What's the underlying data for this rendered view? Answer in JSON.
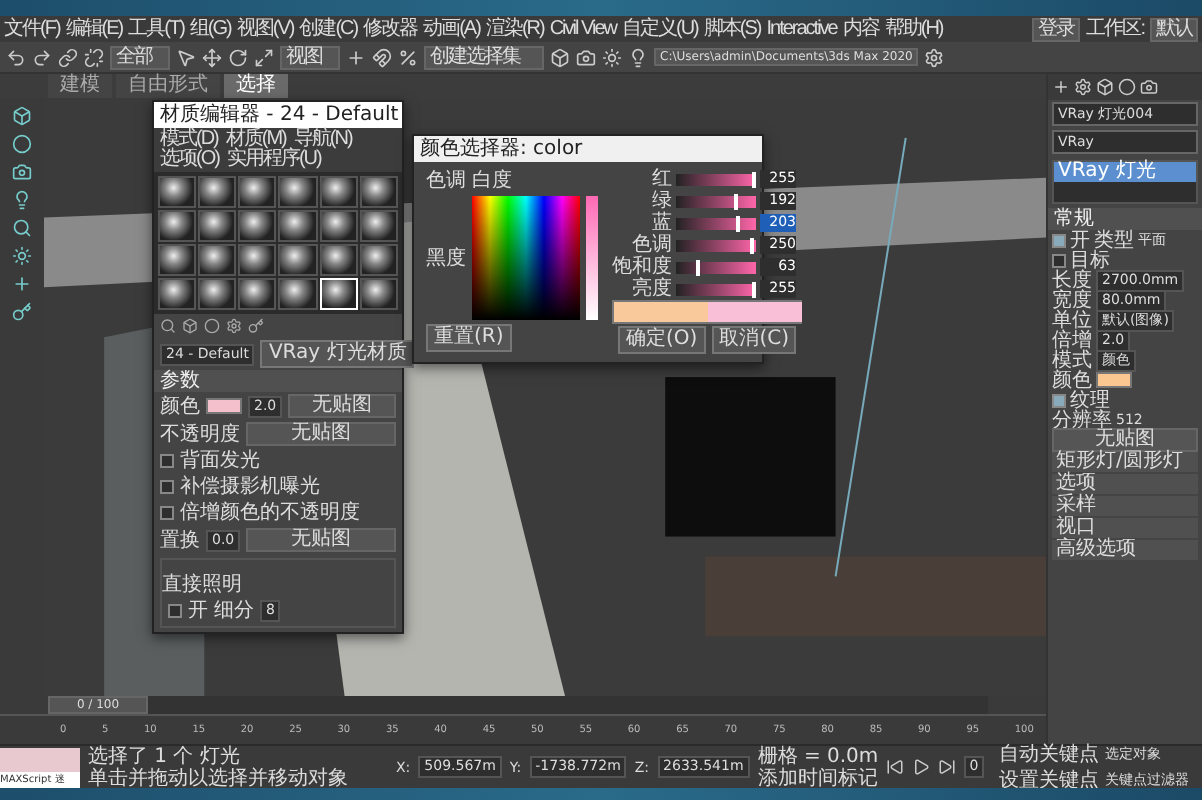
{
  "menu_bar": {
    "items": [
      "文件(F)",
      "编辑(E)",
      "工具(T)",
      "组(G)",
      "视图(V)",
      "创建(C)",
      "修改器",
      "动画(A)",
      "渲染(R)",
      "Civil View",
      "自定义(U)",
      "脚本(S)",
      "Interactive",
      "内容",
      "帮助(H)"
    ],
    "login": "登录",
    "workspace_label": "工作区:",
    "workspace_value": "默认"
  },
  "toolbar": {
    "filter": "全部",
    "coord_system": "视图",
    "selection_set": "创建选择集",
    "project_path": "C:\\Users\\admin\\Documents\\3ds Max 2020"
  },
  "ribbon_tabs": [
    {
      "label": "建模",
      "selected": false
    },
    {
      "label": "自由形式",
      "selected": false
    },
    {
      "label": "选择",
      "selected": true
    }
  ],
  "material_editor": {
    "title": "材质编辑器 - 24 - Default",
    "menu": [
      "模式(D)",
      "材质(M)",
      "导航(N)",
      "选项(O)",
      "实用程序(U)"
    ],
    "slots": [
      {
        "selected": false
      },
      {
        "selected": false
      },
      {
        "selected": false
      },
      {
        "selected": false
      },
      {
        "selected": false
      },
      {
        "selected": false
      },
      {
        "selected": false
      },
      {
        "selected": false
      },
      {
        "selected": false
      },
      {
        "selected": false
      },
      {
        "selected": false
      },
      {
        "selected": false
      },
      {
        "selected": false
      },
      {
        "selected": false
      },
      {
        "selected": false
      },
      {
        "selected": false
      },
      {
        "selected": false
      },
      {
        "selected": false
      },
      {
        "selected": false
      },
      {
        "selected": false
      },
      {
        "selected": false
      },
      {
        "selected": false
      },
      {
        "selected": true
      },
      {
        "selected": false
      }
    ],
    "material_name": "24 - Default",
    "material_type": "VRay 灯光材质",
    "params_title": "参数",
    "color_label": "颜色",
    "color_multiplier": "2.0",
    "color_map": "无贴图",
    "opacity_label": "不透明度",
    "opacity_map": "无贴图",
    "options": [
      {
        "label": "背面发光",
        "checked": false
      },
      {
        "label": "补偿摄影机曝光",
        "checked": false
      },
      {
        "label": "倍增颜色的不透明度",
        "checked": false
      }
    ],
    "displace_label": "置换",
    "displace_value": "0.0",
    "displace_map": "无贴图",
    "direct_title": "直接照明",
    "direct_on": {
      "label": "开",
      "checked": false
    },
    "subdivs_label": "细分",
    "subdivs_value": "8"
  },
  "color_picker": {
    "title": "颜色选择器: color",
    "hue_label": "色调",
    "whiteness_label": "白度",
    "blackness_label": "黑度",
    "channels": [
      {
        "label": "红",
        "value": "255",
        "level": 1.0,
        "selected": false
      },
      {
        "label": "绿",
        "value": "192",
        "level": 0.75,
        "selected": false
      },
      {
        "label": "蓝",
        "value": "203",
        "level": 0.8,
        "selected": true
      },
      {
        "label": "色调",
        "value": "250",
        "level": 0.97,
        "selected": false
      },
      {
        "label": "饱和度",
        "value": "63",
        "level": 0.25,
        "selected": false
      },
      {
        "label": "亮度",
        "value": "255",
        "level": 1.0,
        "selected": false
      }
    ],
    "reset": "重置(R)",
    "ok": "确定(O)",
    "cancel": "取消(C)"
  },
  "command_panel": {
    "object_name": "VRay 灯光004",
    "category": "VRay",
    "object_list": [
      {
        "label": "VRay 灯光",
        "selected": true
      }
    ],
    "rollout_title": "常规",
    "on": {
      "label": "开",
      "checked": true
    },
    "type_label": "类型",
    "type_value": "平面",
    "target": {
      "label": "目标",
      "checked": false
    },
    "rows": [
      {
        "label": "长度",
        "value": "2700.0mm"
      },
      {
        "label": "宽度",
        "value": "80.0mm"
      },
      {
        "label": "单位",
        "value": "默认(图像)"
      },
      {
        "label": "倍增",
        "value": "2.0"
      },
      {
        "label": "模式",
        "value": "颜色"
      }
    ],
    "color_label": "颜色",
    "texture": {
      "label": "纹理",
      "checked": true
    },
    "resolution_label": "分辨率",
    "resolution_value": "512",
    "map_button": "无贴图",
    "collapsed": [
      "矩形灯/圆形灯",
      "选项",
      "采样",
      "视口",
      "高级选项"
    ]
  },
  "timeline": {
    "frame": "0 / 100",
    "ticks": [
      "0",
      "5",
      "10",
      "15",
      "20",
      "25",
      "30",
      "35",
      "40",
      "45",
      "50",
      "55",
      "60",
      "65",
      "70",
      "75",
      "80",
      "85",
      "90",
      "95",
      "100"
    ]
  },
  "status": {
    "script_field": "MAXScript 迷",
    "selection": "选择了 1 个 灯光",
    "prompt": "单击并拖动以选择并移动对象",
    "coords": [
      {
        "axis": "X:",
        "value": "509.567m"
      },
      {
        "axis": "Y:",
        "value": "-1738.772m"
      },
      {
        "axis": "Z:",
        "value": "2633.541m"
      }
    ],
    "grid": "栅格 = 0.0m",
    "time_tag": "添加时间标记",
    "frame_value": "0",
    "auto_key": "自动关键点",
    "key_filter": "选定对象",
    "set_key": "设置关键点",
    "key_filters": "关键点过滤器"
  }
}
